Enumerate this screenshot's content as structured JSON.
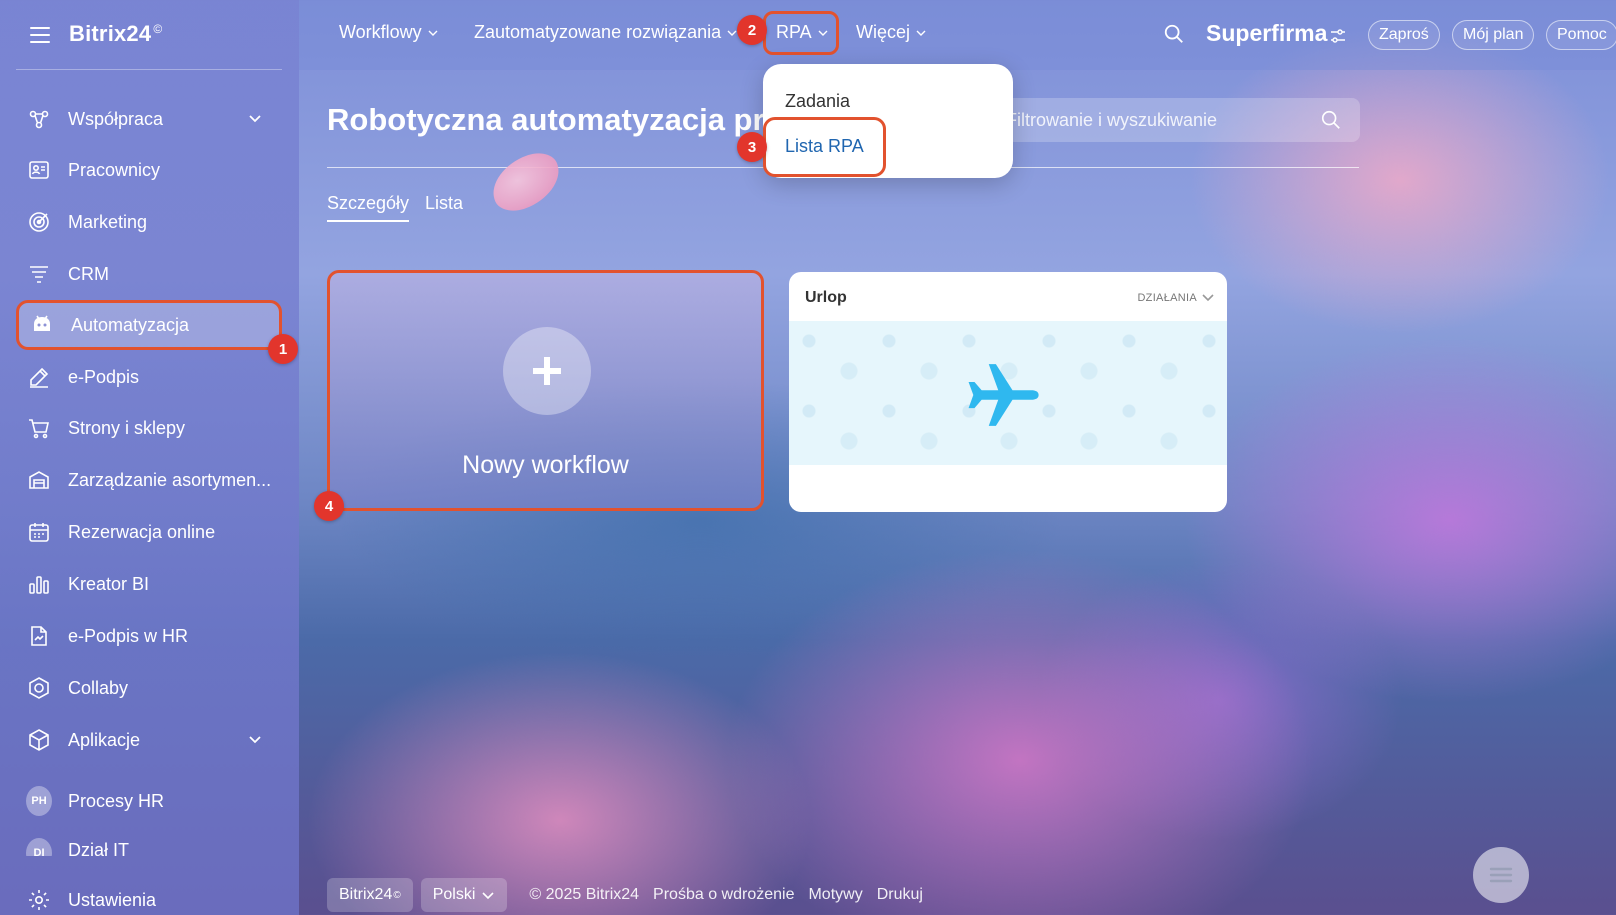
{
  "sidebar": {
    "brand": "Bitrix24",
    "brand_mark": "©",
    "items": [
      {
        "label": "Współpraca",
        "icon": "collaboration-icon",
        "has_chevron": true
      },
      {
        "label": "Pracownicy",
        "icon": "employees-icon"
      },
      {
        "label": "Marketing",
        "icon": "marketing-icon"
      },
      {
        "label": "CRM",
        "icon": "crm-icon"
      },
      {
        "label": "Automatyzacja",
        "icon": "automation-robot-icon",
        "active": true
      },
      {
        "label": "e-Podpis",
        "icon": "e-signature-icon"
      },
      {
        "label": "Strony i sklepy",
        "icon": "shopping-cart-icon"
      },
      {
        "label": "Zarządzanie asortymen...",
        "icon": "inventory-icon"
      },
      {
        "label": "Rezerwacja online",
        "icon": "calendar-icon"
      },
      {
        "label": "Kreator BI",
        "icon": "bar-chart-icon"
      },
      {
        "label": "e-Podpis w HR",
        "icon": "hr-signature-icon"
      },
      {
        "label": "Collaby",
        "icon": "collaby-hexagon-icon"
      },
      {
        "label": "Aplikacje",
        "icon": "apps-cube-icon",
        "has_chevron": true
      },
      {
        "label": "Procesy HR",
        "avatar": "PH"
      },
      {
        "label": "Dział IT",
        "avatar": "DI"
      },
      {
        "label": "Ustawienia",
        "icon": "gear-icon"
      }
    ]
  },
  "topbar": {
    "nav": [
      {
        "label": "Workflowy"
      },
      {
        "label": "Zautomatyzowane rozwiązania"
      },
      {
        "label": "RPA"
      },
      {
        "label": "Więcej"
      }
    ],
    "company": "Superfirma",
    "buttons": {
      "invite": "Zaproś",
      "plan": "Mój plan",
      "help": "Pomoc"
    }
  },
  "dropdown": {
    "items": [
      {
        "label": "Zadania"
      },
      {
        "label": "Lista RPA"
      }
    ]
  },
  "main": {
    "title": "Robotyczna automatyzacja pro",
    "filter_placeholder": "Filtrowanie i wyszukiwanie",
    "tabs": [
      {
        "label": "Szczegóły",
        "active": true
      },
      {
        "label": "Lista"
      }
    ],
    "new_workflow_label": "Nowy workflow",
    "workflow_card": {
      "name": "Urlop",
      "actions_label": "DZIAŁANIA"
    }
  },
  "badges": {
    "b1": "1",
    "b2": "2",
    "b3": "3",
    "b4": "4"
  },
  "footer": {
    "brand": "Bitrix24",
    "brand_mark": "©",
    "language": "Polski",
    "copyright": "© 2025 Bitrix24",
    "links": [
      "Prośba o wdrożenie",
      "Motywy",
      "Drukuj"
    ]
  },
  "colors": {
    "highlight_border": "#e2522e",
    "badge_red": "#e2352c",
    "link_blue": "#2066b0",
    "plane_blue": "#2fb8ef"
  }
}
